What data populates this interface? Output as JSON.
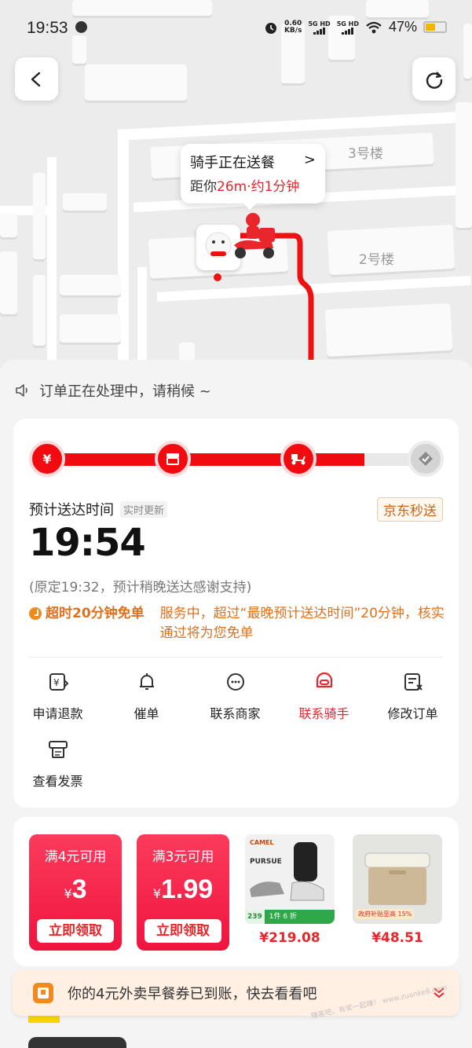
{
  "status_bar": {
    "time": "19:53",
    "net_speed_value": "0.60",
    "net_speed_unit": "KB/s",
    "sim1": "5G HD",
    "sim2": "5G HD",
    "battery_pct": "47%",
    "battery_level": 0.47
  },
  "map": {
    "buildings": [
      "3号楼",
      "2号楼"
    ],
    "route_color": "#ee1111"
  },
  "bubble": {
    "title": "骑手正在送餐",
    "chevron": ">",
    "prefix": "距你",
    "distance": "26m·约1分钟"
  },
  "notice": "订单正在处理中，请稍候 ~",
  "progress": {
    "steps": [
      {
        "icon": "yen-icon",
        "glyph": "¥",
        "done": true
      },
      {
        "icon": "store-icon",
        "done": true
      },
      {
        "icon": "scooter-icon",
        "done": true
      },
      {
        "icon": "check-icon",
        "done": false
      }
    ],
    "fill_fraction": 0.83
  },
  "eta": {
    "label": "预计送达时间",
    "realtime_tag": "实时更新",
    "brand": "京东秒送",
    "time": "19:54",
    "original": "(原定19:32，预计稍晚送达感谢支持)",
    "late_key": "超时20分钟免单",
    "late_desc": "服务中，超过“最晚预计送达时间”20分钟，核实通过将为您免单"
  },
  "actions": [
    {
      "label": "申请退款",
      "icon": "refund-icon"
    },
    {
      "label": "催单",
      "icon": "bell-icon"
    },
    {
      "label": "联系商家",
      "icon": "merchant-chat-icon"
    },
    {
      "label": "联系骑手",
      "icon": "rider-icon",
      "active": true
    },
    {
      "label": "修改订单",
      "icon": "edit-order-icon"
    },
    {
      "label": "查看发票",
      "icon": "invoice-icon"
    }
  ],
  "coupons": [
    {
      "title": "满4元可用",
      "currency": "¥",
      "amount": "3",
      "button": "立即领取"
    },
    {
      "title": "满3元可用",
      "currency": "¥",
      "amount": "1.99",
      "button": "立即领取"
    }
  ],
  "products": [
    {
      "name": "shoes",
      "brand": "CAMEL",
      "subtitle": "PURSUE",
      "badge_num": "239",
      "badge_text": "1件 6 折",
      "price": "¥219.08"
    },
    {
      "name": "cooler-box",
      "badge_text": "政府补贴至高 15%",
      "price": "¥48.51"
    }
  ],
  "toast": {
    "text": "你的4元外卖早餐券已到账，快去看看吧",
    "watermark": "赚客吧，有奖一起赚！ www.zuanke8.com"
  },
  "peek_text": "·"
}
